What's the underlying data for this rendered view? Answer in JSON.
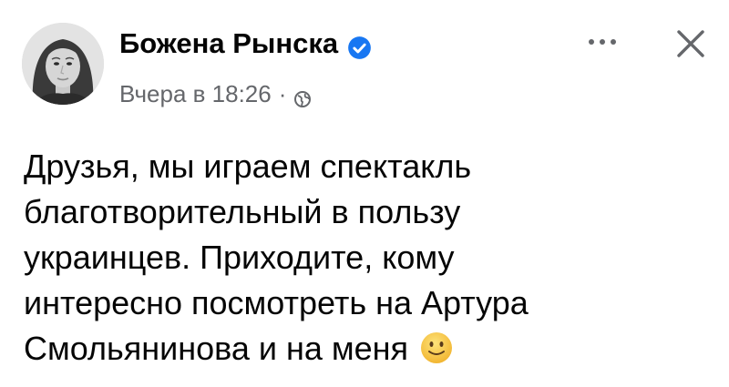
{
  "post": {
    "author_name": "Божена Рынска",
    "timestamp": "Вчера в 18:26",
    "separator": "·",
    "audience_icon": "globe-icon",
    "verified_icon": "verified-badge-icon",
    "more_icon": "more-options-icon",
    "close_icon": "close-icon",
    "text_lines": [
      "Друзья, мы играем спектакль",
      "благотворительный в пользу",
      "украинцев. Приходите, кому",
      "интересно посмотреть на Артура",
      "Смольянинова и на меня"
    ],
    "trailing_emoji": "slightly-smiling-face-icon"
  },
  "colors": {
    "text": "#050505",
    "secondary_text": "#65676b",
    "verified_blue": "#1877f2",
    "emoji_yellow": "#f7c948",
    "icon_gray": "#65676b"
  }
}
